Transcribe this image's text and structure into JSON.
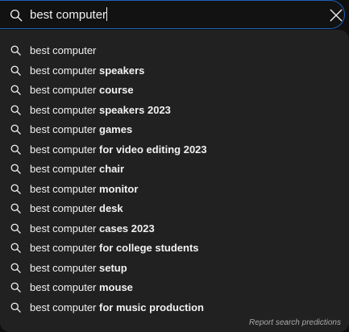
{
  "search": {
    "value": "best computer"
  },
  "suggestions": [
    {
      "prefix": "best computer",
      "completion": ""
    },
    {
      "prefix": "best computer ",
      "completion": "speakers"
    },
    {
      "prefix": "best computer ",
      "completion": "course"
    },
    {
      "prefix": "best computer ",
      "completion": "speakers 2023"
    },
    {
      "prefix": "best computer ",
      "completion": "games"
    },
    {
      "prefix": "best computer ",
      "completion": "for video editing 2023"
    },
    {
      "prefix": "best computer ",
      "completion": "chair"
    },
    {
      "prefix": "best computer ",
      "completion": "monitor"
    },
    {
      "prefix": "best computer ",
      "completion": "desk"
    },
    {
      "prefix": "best computer ",
      "completion": "cases 2023"
    },
    {
      "prefix": "best computer ",
      "completion": "for college students"
    },
    {
      "prefix": "best computer ",
      "completion": "setup"
    },
    {
      "prefix": "best computer ",
      "completion": "mouse"
    },
    {
      "prefix": "best computer ",
      "completion": "for music production"
    }
  ],
  "footer": {
    "report_label": "Report search predictions"
  },
  "icons": {
    "search": "search-icon",
    "clear": "close-icon"
  },
  "colors": {
    "focus_border": "#1c62b9",
    "dropdown_bg": "#212121",
    "text": "#f1f1f1",
    "muted": "#aaaaaa"
  }
}
